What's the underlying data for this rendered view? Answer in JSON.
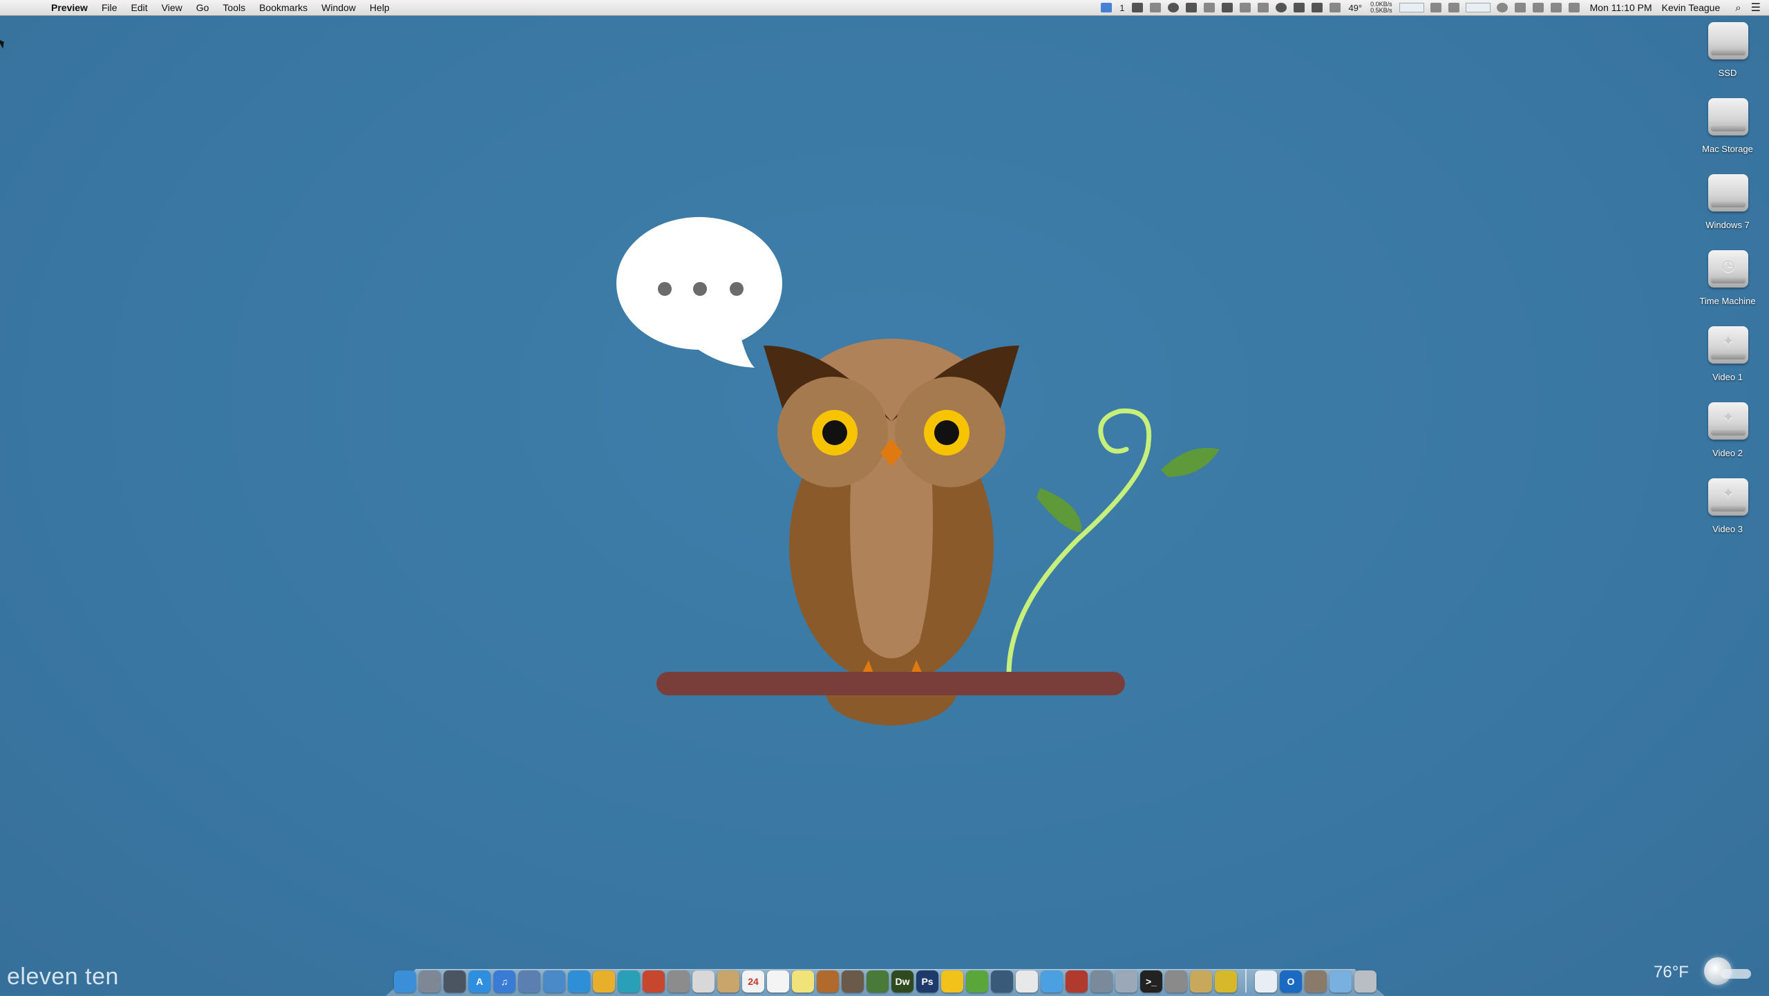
{
  "menubar": {
    "apple_glyph": "",
    "app_name": "Preview",
    "menus": [
      "File",
      "Edit",
      "View",
      "Go",
      "Tools",
      "Bookmarks",
      "Window",
      "Help"
    ],
    "status": {
      "cursor_count": "1",
      "temperature": "49°",
      "net_up": "0.0KB/s",
      "net_down": "0.5KB/s",
      "clock": "Mon 11:10 PM",
      "user": "Kevin Teague"
    }
  },
  "drives": [
    {
      "label": "SSD",
      "icon": "internal-drive-icon"
    },
    {
      "label": "Mac Storage",
      "icon": "internal-drive-icon"
    },
    {
      "label": "Windows 7",
      "icon": "internal-drive-icon"
    },
    {
      "label": "Time Machine",
      "icon": "time-machine-drive-icon"
    },
    {
      "label": "Video 1",
      "icon": "external-drive-icon"
    },
    {
      "label": "Video 2",
      "icon": "external-drive-icon"
    },
    {
      "label": "Video 3",
      "icon": "external-drive-icon"
    }
  ],
  "speech_bubble": {
    "text": "• • •"
  },
  "corner_text": "eleven ten",
  "weather": {
    "temperature": "76°F"
  },
  "dock": {
    "apps": [
      {
        "name": "finder",
        "color": "#3b8fd9",
        "glyph": ""
      },
      {
        "name": "launchpad",
        "color": "#7d8894",
        "glyph": ""
      },
      {
        "name": "mission-control",
        "color": "#4b5562",
        "glyph": ""
      },
      {
        "name": "app-store",
        "color": "#2e8fe0",
        "glyph": "A"
      },
      {
        "name": "itunes",
        "color": "#3a7bd5",
        "glyph": "♫"
      },
      {
        "name": "preview",
        "color": "#5b7fb0",
        "glyph": ""
      },
      {
        "name": "mail",
        "color": "#4a8ac8",
        "glyph": ""
      },
      {
        "name": "safari",
        "color": "#2f8fd6",
        "glyph": ""
      },
      {
        "name": "chrome",
        "color": "#e8b02a",
        "glyph": ""
      },
      {
        "name": "network-radar",
        "color": "#2aa0b8",
        "glyph": ""
      },
      {
        "name": "transmission",
        "color": "#c7472e",
        "glyph": ""
      },
      {
        "name": "mouse-utility",
        "color": "#8c8c8c",
        "glyph": ""
      },
      {
        "name": "coffee-app",
        "color": "#d8d8d8",
        "glyph": ""
      },
      {
        "name": "notebook",
        "color": "#c8a56a",
        "glyph": ""
      },
      {
        "name": "calendar",
        "color": "#f2f2f2",
        "glyph": "24"
      },
      {
        "name": "textedit",
        "color": "#f4f4f4",
        "glyph": ""
      },
      {
        "name": "stickies",
        "color": "#f1e27a",
        "glyph": ""
      },
      {
        "name": "acorn",
        "color": "#b06a2e",
        "glyph": ""
      },
      {
        "name": "photos",
        "color": "#6b5a4a",
        "glyph": ""
      },
      {
        "name": "pixelmator",
        "color": "#4a7a3a",
        "glyph": ""
      },
      {
        "name": "dreamweaver",
        "color": "#2f4a1e",
        "glyph": "Dw"
      },
      {
        "name": "photoshop",
        "color": "#1e3a6a",
        "glyph": "Ps"
      },
      {
        "name": "cyberduck",
        "color": "#f2c21a",
        "glyph": ""
      },
      {
        "name": "evernote",
        "color": "#5aa63a",
        "glyph": ""
      },
      {
        "name": "glasses-app",
        "color": "#3a5a7a",
        "glyph": ""
      },
      {
        "name": "panda-app",
        "color": "#e8e8e8",
        "glyph": ""
      },
      {
        "name": "messages",
        "color": "#4aa0e0",
        "glyph": ""
      },
      {
        "name": "coffee-cup",
        "color": "#b03a2e",
        "glyph": ""
      },
      {
        "name": "xcode",
        "color": "#7a8a9a",
        "glyph": ""
      },
      {
        "name": "script-editor",
        "color": "#9aa8b8",
        "glyph": ""
      },
      {
        "name": "terminal",
        "color": "#222222",
        "glyph": ">_"
      },
      {
        "name": "system-preferences",
        "color": "#8a8a8a",
        "glyph": ""
      },
      {
        "name": "utility-tool",
        "color": "#c8a85a",
        "glyph": ""
      },
      {
        "name": "bittorrent",
        "color": "#d6b82a",
        "glyph": ""
      }
    ],
    "stacks": [
      {
        "name": "documents-stack",
        "color": "#e8eef4",
        "glyph": ""
      },
      {
        "name": "outlook",
        "color": "#1a6ac2",
        "glyph": "O"
      },
      {
        "name": "image-stack",
        "color": "#8a7a6a",
        "glyph": ""
      },
      {
        "name": "downloads-folder",
        "color": "#7ab0e0",
        "glyph": ""
      },
      {
        "name": "trash",
        "color": "#b8bec4",
        "glyph": ""
      }
    ]
  },
  "colors": {
    "desktop": "#3b79a6",
    "owl_body_dark": "#8b5a2b",
    "owl_body_light": "#b0825a",
    "owl_ears": "#4a2a10",
    "owl_eye_ring": "#f6c400",
    "owl_beak": "#e07a10",
    "branch": "#7a3e3a",
    "vine": "#c6f07a",
    "leaf": "#5e9a3a"
  }
}
